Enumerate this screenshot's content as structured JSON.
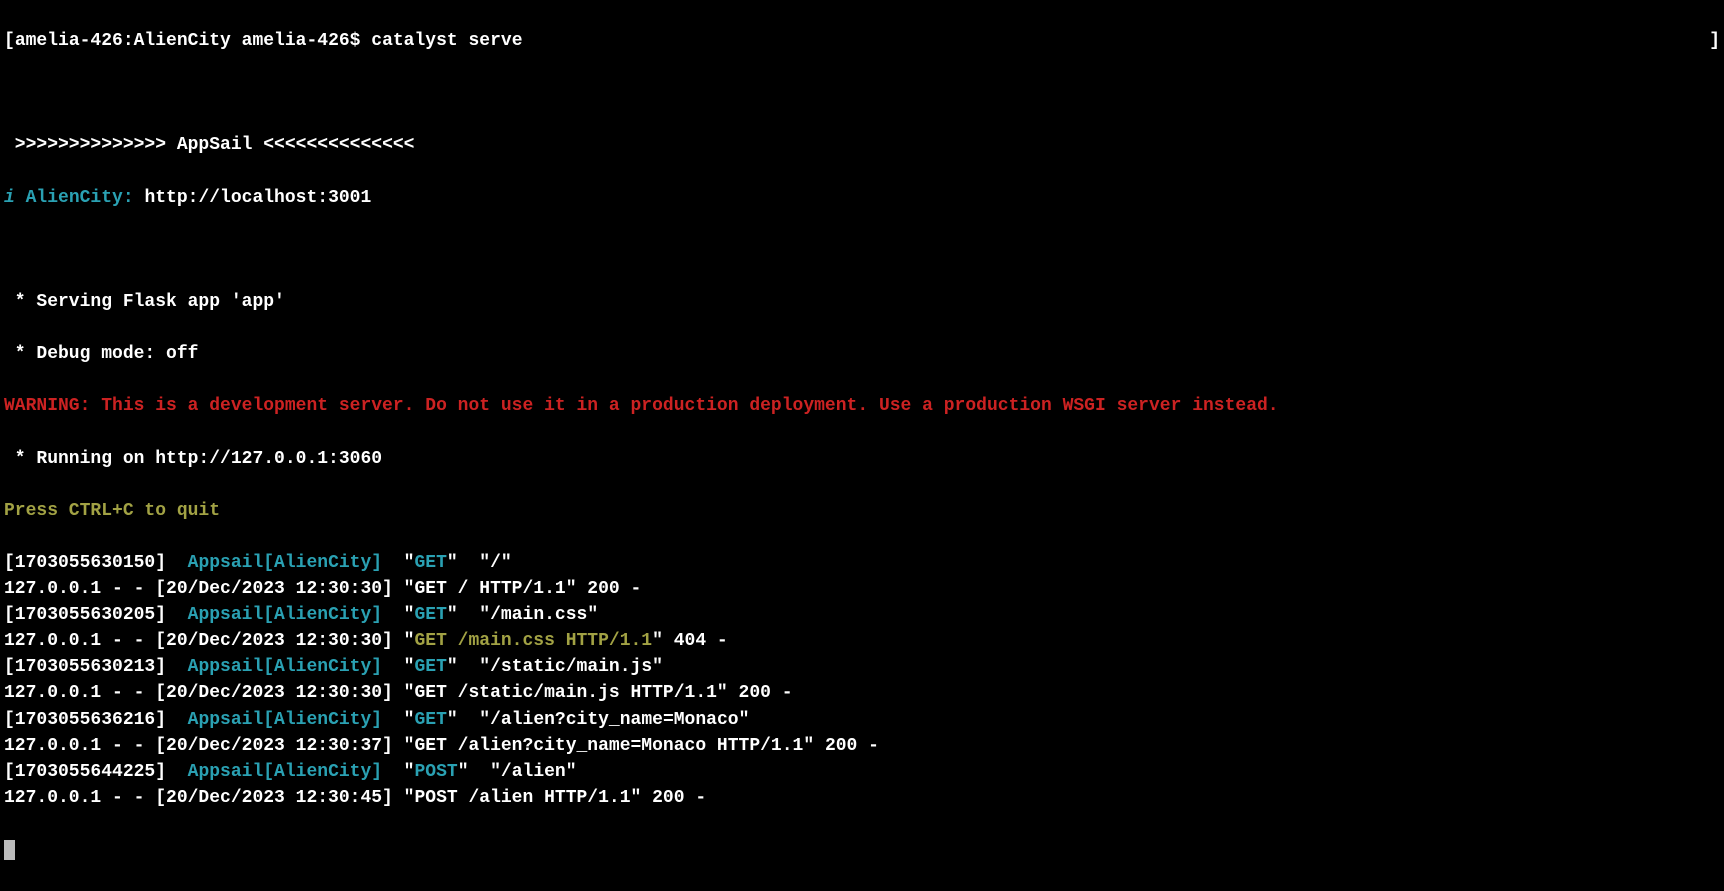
{
  "prompt": {
    "open_bracket": "[",
    "host_path": "amelia-426:AlienCity amelia-426$",
    "command": " catalyst serve",
    "close_bracket": "]"
  },
  "banner": {
    "prefix": " >>>>>>>>>>>>>> ",
    "title": "AppSail",
    "suffix": " <<<<<<<<<<<<<<"
  },
  "info": {
    "icon": "i",
    "app_name": " AlienCity: ",
    "url": "http://localhost:3001"
  },
  "flask": {
    "serving": " * Serving Flask app 'app'",
    "debug": " * Debug mode: off",
    "warning": "WARNING: This is a development server. Do not use it in a production deployment. Use a production WSGI server instead.",
    "running": " * Running on http://127.0.0.1:3060",
    "quit": "Press CTRL+C to quit"
  },
  "logs": [
    {
      "ts": "[1703055630150]  ",
      "appsail": "Appsail[AlienCity]",
      "method_q": "  \"",
      "method": "GET",
      "method_close": "\"  \"",
      "path": "/",
      "path_close": "\"",
      "access_prefix": "127.0.0.1 - - [20/Dec/2023 12:30:30] \"",
      "access_req": "GET / HTTP/1.1",
      "access_suffix": "\" 200 -",
      "req_highlight": false
    },
    {
      "ts": "[1703055630205]  ",
      "appsail": "Appsail[AlienCity]",
      "method_q": "  \"",
      "method": "GET",
      "method_close": "\"  \"",
      "path": "/main.css",
      "path_close": "\"",
      "access_prefix": "127.0.0.1 - - [20/Dec/2023 12:30:30] \"",
      "access_req": "GET /main.css HTTP/1.1",
      "access_suffix": "\" 404 -",
      "req_highlight": true
    },
    {
      "ts": "[1703055630213]  ",
      "appsail": "Appsail[AlienCity]",
      "method_q": "  \"",
      "method": "GET",
      "method_close": "\"  \"",
      "path": "/static/main.js",
      "path_close": "\"",
      "access_prefix": "127.0.0.1 - - [20/Dec/2023 12:30:30] \"",
      "access_req": "GET /static/main.js HTTP/1.1",
      "access_suffix": "\" 200 -",
      "req_highlight": false
    },
    {
      "ts": "[1703055636216]  ",
      "appsail": "Appsail[AlienCity]",
      "method_q": "  \"",
      "method": "GET",
      "method_close": "\"  \"",
      "path": "/alien?city_name=Monaco",
      "path_close": "\"",
      "access_prefix": "127.0.0.1 - - [20/Dec/2023 12:30:37] \"",
      "access_req": "GET /alien?city_name=Monaco HTTP/1.1",
      "access_suffix": "\" 200 -",
      "req_highlight": false
    },
    {
      "ts": "[1703055644225]  ",
      "appsail": "Appsail[AlienCity]",
      "method_q": "  \"",
      "method": "POST",
      "method_close": "\"  \"",
      "path": "/alien",
      "path_close": "\"",
      "access_prefix": "127.0.0.1 - - [20/Dec/2023 12:30:45] \"",
      "access_req": "POST /alien HTTP/1.1",
      "access_suffix": "\" 200 -",
      "req_highlight": false
    }
  ]
}
